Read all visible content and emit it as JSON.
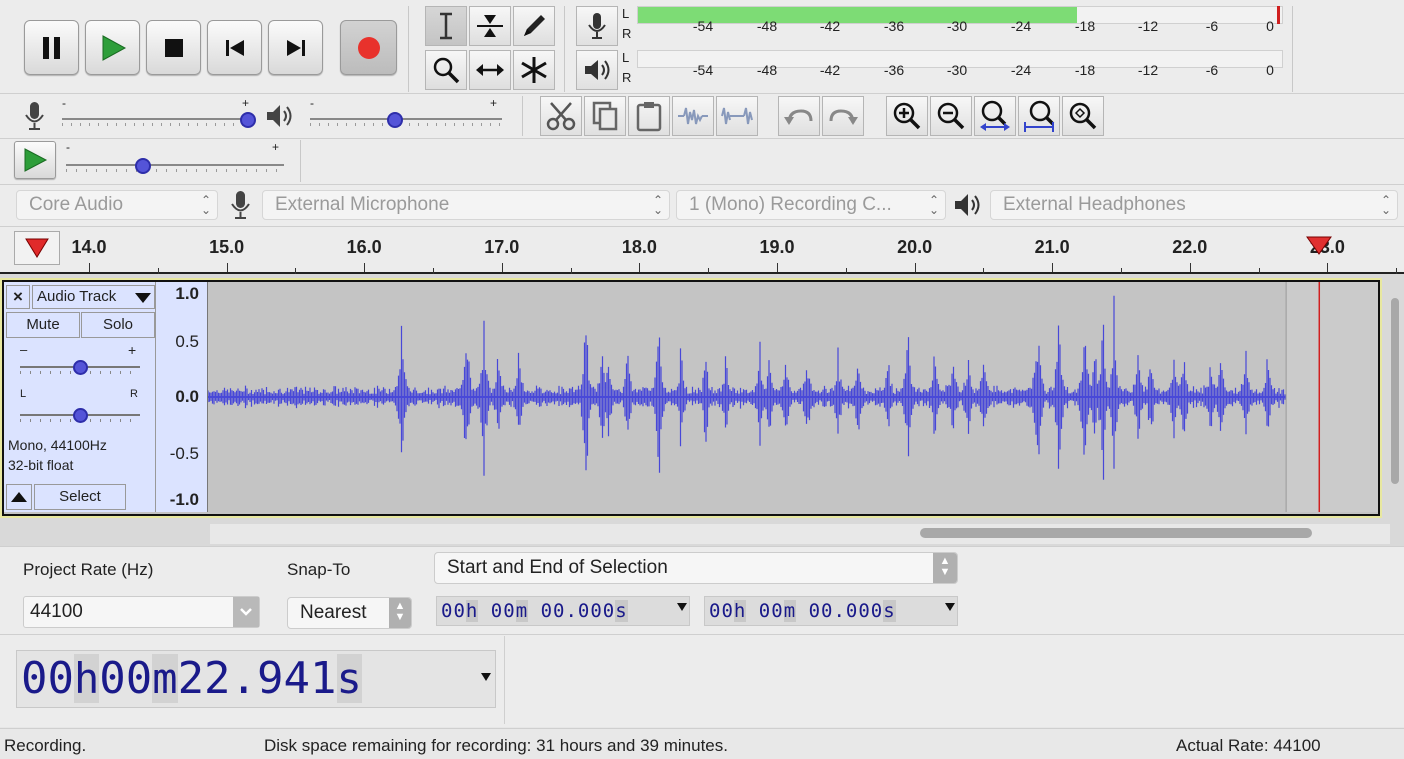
{
  "transport": {
    "buttons": [
      {
        "name": "pause-button",
        "icon": "pause-icon"
      },
      {
        "name": "play-button",
        "icon": "play-icon"
      },
      {
        "name": "stop-button",
        "icon": "stop-icon"
      },
      {
        "name": "skip-to-start-button",
        "icon": "skip-start-icon"
      },
      {
        "name": "skip-to-end-button",
        "icon": "skip-end-icon"
      },
      {
        "name": "record-button",
        "icon": "record-icon"
      }
    ]
  },
  "tools": [
    "selection-tool",
    "envelope-tool",
    "draw-tool",
    "zoom-tool",
    "time-shift-tool",
    "multi-tool"
  ],
  "meters": {
    "record": {
      "channel_top": "L",
      "channel_bottom": "R",
      "level_fraction": 0.68
    },
    "playback": {
      "channel_top": "L",
      "channel_bottom": "R",
      "level_fraction": 0
    },
    "ticks": [
      "-54",
      "-48",
      "-42",
      "-36",
      "-30",
      "-24",
      "-18",
      "-12",
      "-6",
      "0"
    ],
    "level_color": "#7ddc75"
  },
  "mixer": {
    "record_volume_fraction": 1.0,
    "playback_volume_fraction": 0.43,
    "minus": "-",
    "plus": "+"
  },
  "play_at_speed": {
    "speed_fraction": 0.34,
    "minus": "-",
    "plus": "+"
  },
  "devices": {
    "host": "Core Audio",
    "recording_device": "External Microphone",
    "channels": "1 (Mono) Recording C...",
    "playback_device": "External Headphones"
  },
  "timeline": {
    "labels": [
      "14.0",
      "15.0",
      "16.0",
      "17.0",
      "18.0",
      "19.0",
      "20.0",
      "21.0",
      "22.0",
      "23.0"
    ],
    "play_head_time": 22.941
  },
  "track": {
    "name": "Audio Track",
    "close_symbol": "×",
    "mute": "Mute",
    "solo": "Solo",
    "gain_minus": "–",
    "gain_plus": "+",
    "pan_left": "L",
    "pan_right": "R",
    "gain_fraction": 0.5,
    "pan_fraction": 0.5,
    "info_line1": "Mono, 44100Hz",
    "info_line2": "32-bit float",
    "select": "Select",
    "scale": [
      "1.0",
      "0.5",
      "0.0",
      "-0.5",
      "-1.0"
    ],
    "wave_color": "#4848d8",
    "bg_color": "#c4c4c4",
    "recorded_until": 22.7
  },
  "selection_toolbar": {
    "project_rate_label": "Project Rate (Hz)",
    "project_rate_value": "44100",
    "snap_to_label": "Snap-To",
    "snap_to_value": "Nearest",
    "selection_mode": "Start and End of Selection",
    "start": {
      "h": "00",
      "m": "00",
      "s": "00.000"
    },
    "end": {
      "h": "00",
      "m": "00",
      "s": "00.000"
    }
  },
  "time_display": {
    "h": "00",
    "m": "00",
    "s": "22.941",
    "hu": "h",
    "mu": "m",
    "su": "s"
  },
  "status_bar": {
    "state": "Recording.",
    "disk": "Disk space remaining for recording: 31 hours and 39 minutes.",
    "rate": "Actual Rate: 44100"
  }
}
